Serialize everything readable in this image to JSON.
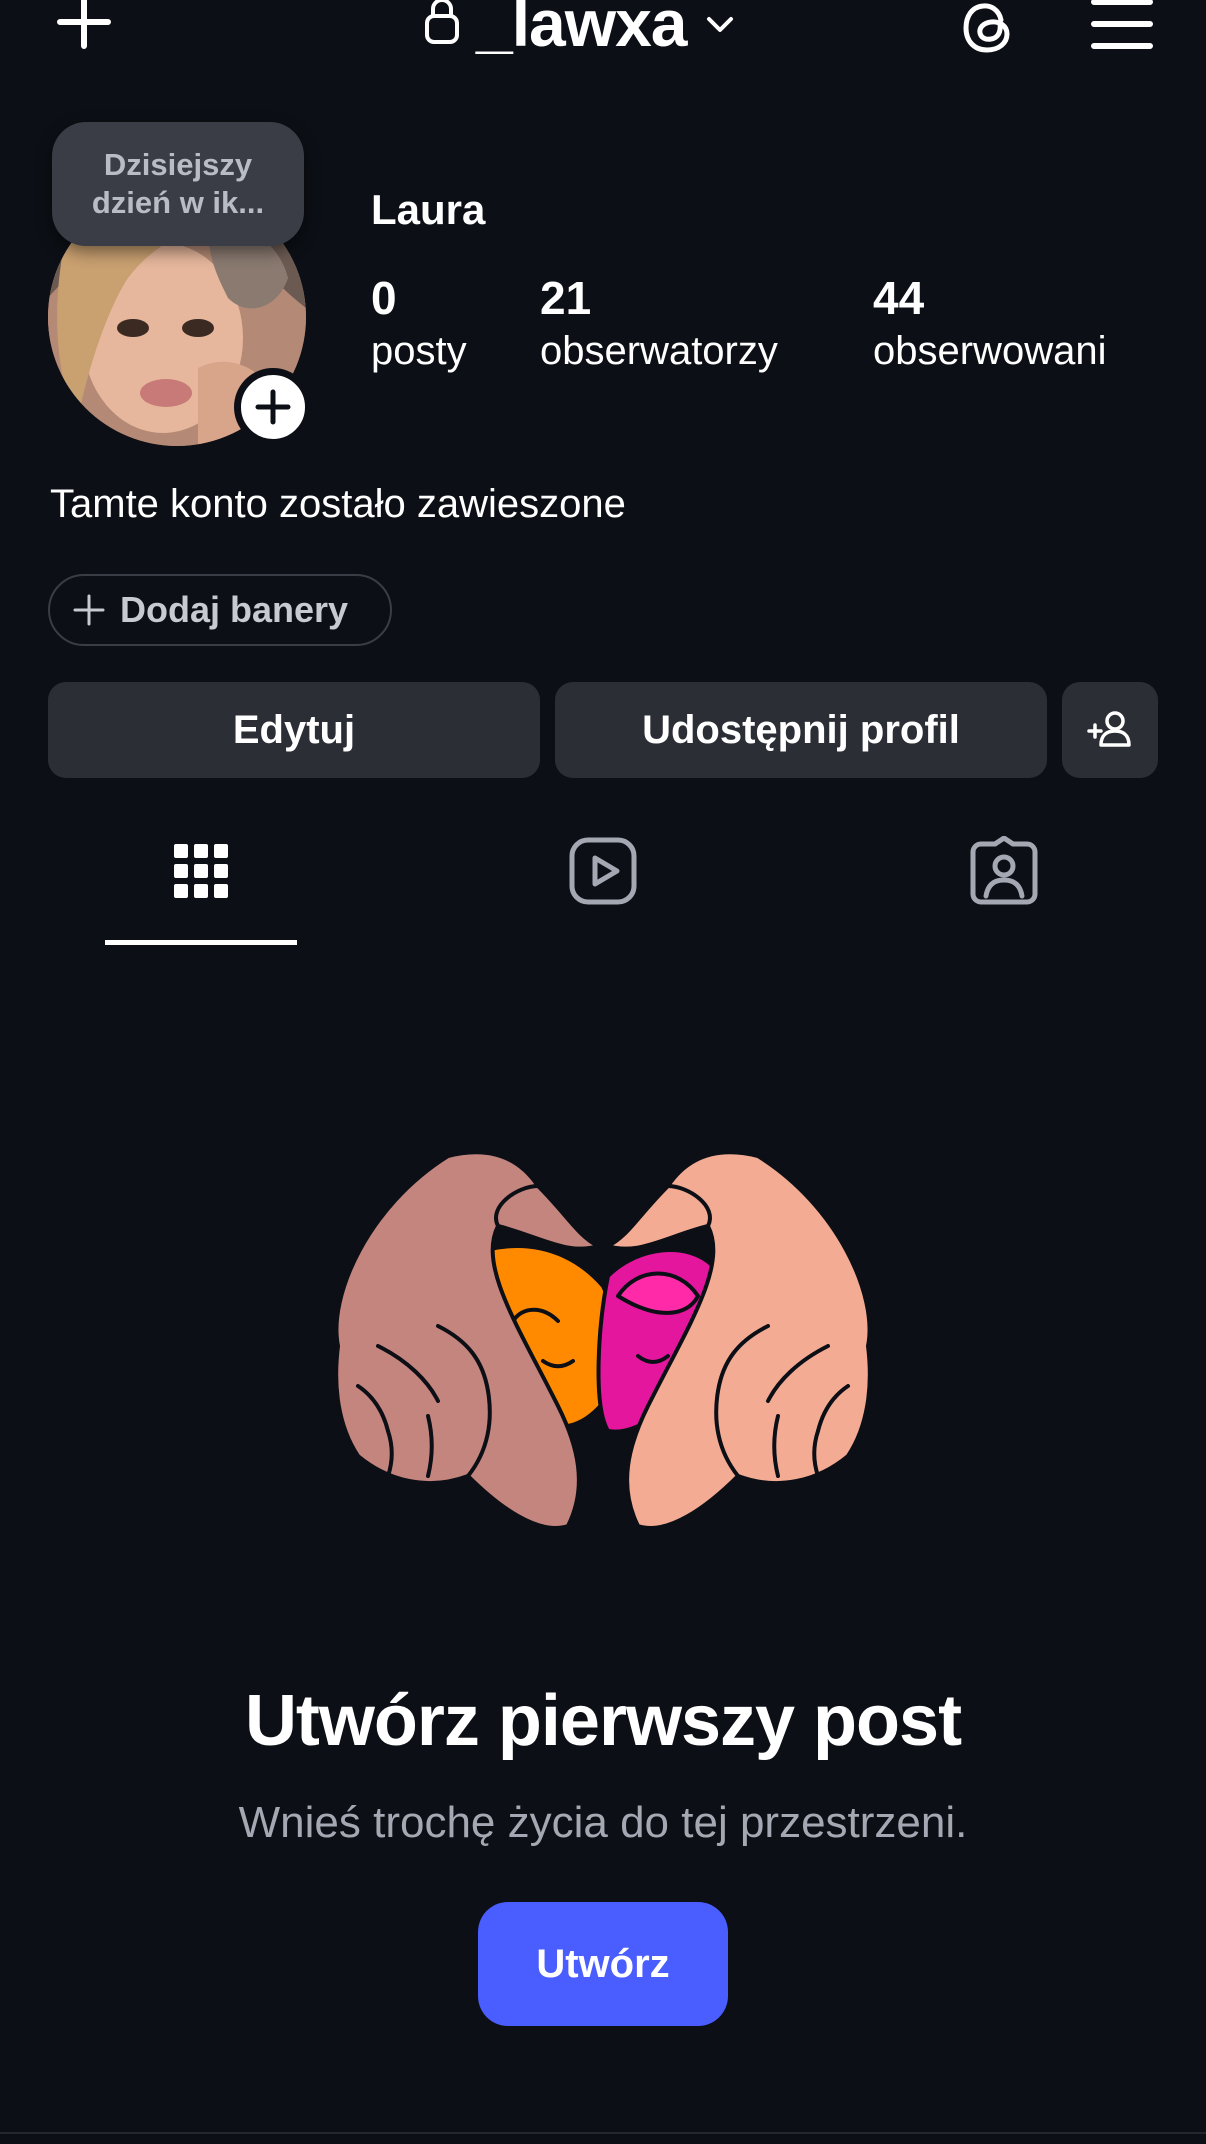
{
  "header": {
    "username": "_lawxa",
    "icons": {
      "create": "plus-icon",
      "lock": "lock-icon",
      "switcher": "chevron-down-icon",
      "threads": "threads-icon",
      "menu": "menu-icon"
    }
  },
  "profile": {
    "note": {
      "line1": "Dzisiejszy",
      "line2": "dzień w ik..."
    },
    "display_name": "Laura",
    "stats": {
      "posts": {
        "count": "0",
        "label": "posty"
      },
      "followers": {
        "count": "21",
        "label": "obserwatorzy"
      },
      "following": {
        "count": "44",
        "label": "obserwowani"
      }
    },
    "bio": "Tamte konto zostało zawieszone",
    "banner_button": "Dodaj banery"
  },
  "actions": {
    "edit": "Edytuj",
    "share": "Udostępnij profil"
  },
  "tabs": [
    {
      "icon": "grid-icon",
      "active": true
    },
    {
      "icon": "reels-icon",
      "active": false
    },
    {
      "icon": "tagged-icon",
      "active": false
    }
  ],
  "empty_state": {
    "title": "Utwórz pierwszy post",
    "subtitle": "Wnieś trochę życia do tej przestrzeni.",
    "button": "Utwórz"
  },
  "colors": {
    "background": "#0c0f15",
    "button_bg": "#2b2e35",
    "accent": "#4a5dff",
    "muted_text": "#a4a8b2"
  }
}
